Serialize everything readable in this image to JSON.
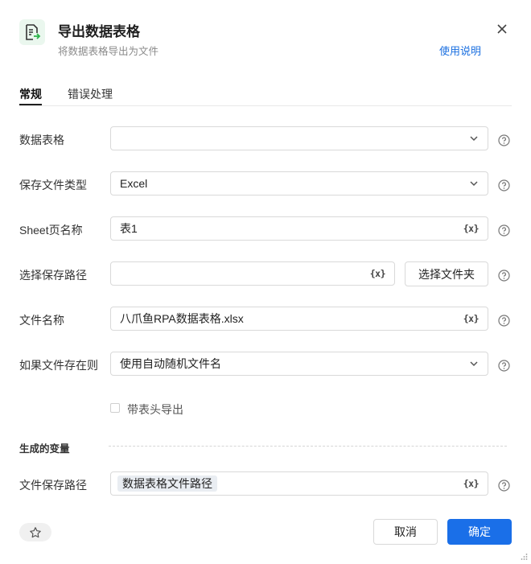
{
  "dialog": {
    "title": "导出数据表格",
    "subtitle": "将数据表格导出为文件",
    "help_link": "使用说明",
    "icon": "export-spreadsheet-icon"
  },
  "tabs": [
    {
      "label": "常规",
      "active": true
    },
    {
      "label": "错误处理",
      "active": false
    }
  ],
  "fields": {
    "data_table": {
      "label": "数据表格",
      "value": ""
    },
    "file_type": {
      "label": "保存文件类型",
      "value": "Excel"
    },
    "sheet_name": {
      "label": "Sheet页名称",
      "value": "表1"
    },
    "save_path": {
      "label": "选择保存路径",
      "value": "",
      "button": "选择文件夹"
    },
    "file_name": {
      "label": "文件名称",
      "value": "八爪鱼RPA数据表格.xlsx"
    },
    "if_exists": {
      "label": "如果文件存在则",
      "value": "使用自动随机文件名"
    }
  },
  "with_header": {
    "label": "带表头导出",
    "checked": false
  },
  "output": {
    "section_label": "生成的变量",
    "path_label": "文件保存路径",
    "path_variable": "数据表格文件路径"
  },
  "variable_marker": "{x}",
  "footer": {
    "cancel": "取消",
    "confirm": "确定"
  },
  "colors": {
    "accent": "#1a6fe8",
    "icon_green": "#2bb44a"
  }
}
